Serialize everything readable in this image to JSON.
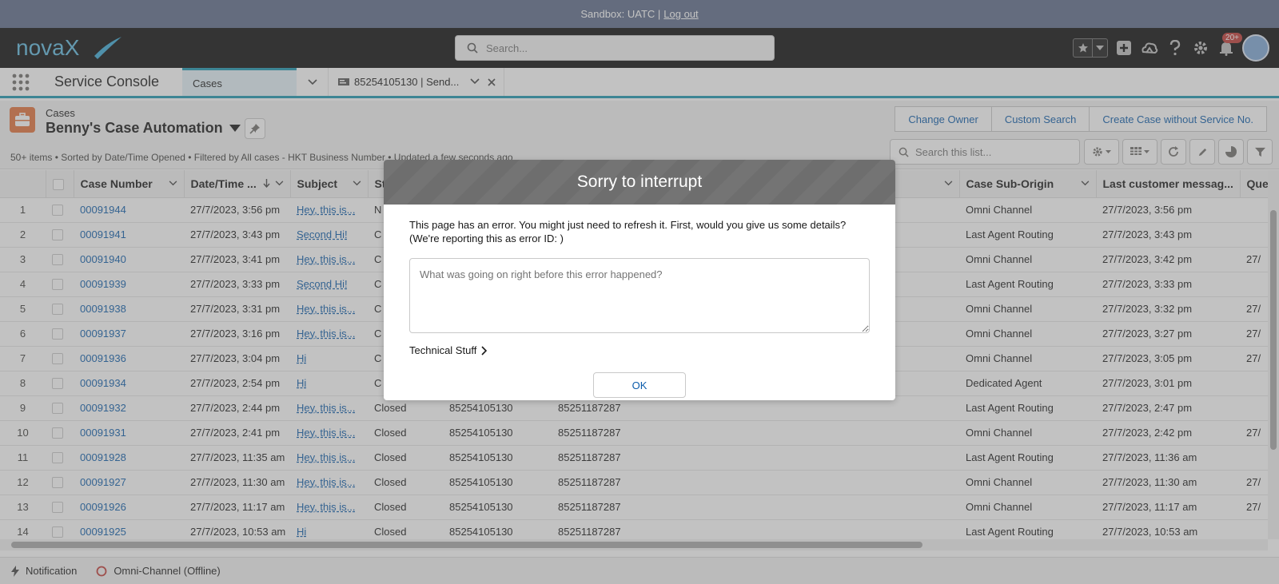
{
  "sandbox": {
    "label": "Sandbox: UATC |",
    "logout": "Log out"
  },
  "header": {
    "logo_text": "novaX",
    "search_placeholder": "Search...",
    "notification_badge": "20+"
  },
  "appnav": {
    "app_name": "Service Console",
    "tabs": [
      {
        "label": "Cases"
      },
      {
        "label": "85254105130 | Send..."
      }
    ]
  },
  "list": {
    "object_label": "Cases",
    "list_name": "Benny's Case Automation",
    "meta": "50+ items • Sorted by Date/Time Opened • Filtered by All cases - HKT Business Number • Updated a few seconds ago",
    "buttons": [
      "Change Owner",
      "Custom Search",
      "Create Case without Service No."
    ],
    "search_placeholder": "Search this list..."
  },
  "table": {
    "columns": [
      "Case Number",
      "Date/Time ...",
      "Subject",
      "St",
      "",
      "",
      "Case Sub-Origin",
      "Last customer messag...",
      "Queue"
    ],
    "rows": [
      {
        "n": "1",
        "case": "00091944",
        "opened": "27/7/2023, 3:56 pm",
        "subject": "Hey, this is...",
        "status": "N",
        "svc": "",
        "contact": "",
        "suborigin": "Omni Channel",
        "last": "27/7/2023, 3:56 pm",
        "queue": ""
      },
      {
        "n": "2",
        "case": "00091941",
        "opened": "27/7/2023, 3:43 pm",
        "subject": "Second Hi!",
        "status": "C",
        "svc": "",
        "contact": "",
        "suborigin": "Last Agent Routing",
        "last": "27/7/2023, 3:43 pm",
        "queue": ""
      },
      {
        "n": "3",
        "case": "00091940",
        "opened": "27/7/2023, 3:41 pm",
        "subject": "Hey, this is...",
        "status": "C",
        "svc": "",
        "contact": "",
        "suborigin": "Omni Channel",
        "last": "27/7/2023, 3:42 pm",
        "queue": "27/"
      },
      {
        "n": "4",
        "case": "00091939",
        "opened": "27/7/2023, 3:33 pm",
        "subject": "Second Hi!",
        "status": "C",
        "svc": "",
        "contact": "",
        "suborigin": "Last Agent Routing",
        "last": "27/7/2023, 3:33 pm",
        "queue": ""
      },
      {
        "n": "5",
        "case": "00091938",
        "opened": "27/7/2023, 3:31 pm",
        "subject": "Hey, this is...",
        "status": "C",
        "svc": "",
        "contact": "",
        "suborigin": "Omni Channel",
        "last": "27/7/2023, 3:32 pm",
        "queue": "27/"
      },
      {
        "n": "6",
        "case": "00091937",
        "opened": "27/7/2023, 3:16 pm",
        "subject": "Hey, this is...",
        "status": "C",
        "svc": "",
        "contact": "",
        "suborigin": "Omni Channel",
        "last": "27/7/2023, 3:27 pm",
        "queue": "27/"
      },
      {
        "n": "7",
        "case": "00091936",
        "opened": "27/7/2023, 3:04 pm",
        "subject": "Hi",
        "status": "C",
        "svc": "",
        "contact": "",
        "suborigin": "Omni Channel",
        "last": "27/7/2023, 3:05 pm",
        "queue": "27/"
      },
      {
        "n": "8",
        "case": "00091934",
        "opened": "27/7/2023, 2:54 pm",
        "subject": "Hi",
        "status": "C",
        "svc": "",
        "contact": "",
        "suborigin": "Dedicated Agent",
        "last": "27/7/2023, 3:01 pm",
        "queue": ""
      },
      {
        "n": "9",
        "case": "00091932",
        "opened": "27/7/2023, 2:44 pm",
        "subject": "Hey, this is...",
        "status": "Closed",
        "svc": "85254105130",
        "contact": "85251187287",
        "suborigin": "Last Agent Routing",
        "last": "27/7/2023, 2:47 pm",
        "queue": ""
      },
      {
        "n": "10",
        "case": "00091931",
        "opened": "27/7/2023, 2:41 pm",
        "subject": "Hey, this is...",
        "status": "Closed",
        "svc": "85254105130",
        "contact": "85251187287",
        "suborigin": "Omni Channel",
        "last": "27/7/2023, 2:42 pm",
        "queue": "27/"
      },
      {
        "n": "11",
        "case": "00091928",
        "opened": "27/7/2023, 11:35 am",
        "subject": "Hey, this is...",
        "status": "Closed",
        "svc": "85254105130",
        "contact": "85251187287",
        "suborigin": "Last Agent Routing",
        "last": "27/7/2023, 11:36 am",
        "queue": ""
      },
      {
        "n": "12",
        "case": "00091927",
        "opened": "27/7/2023, 11:30 am",
        "subject": "Hey, this is...",
        "status": "Closed",
        "svc": "85254105130",
        "contact": "85251187287",
        "suborigin": "Omni Channel",
        "last": "27/7/2023, 11:30 am",
        "queue": "27/"
      },
      {
        "n": "13",
        "case": "00091926",
        "opened": "27/7/2023, 11:17 am",
        "subject": "Hey, this is...",
        "status": "Closed",
        "svc": "85254105130",
        "contact": "85251187287",
        "suborigin": "Omni Channel",
        "last": "27/7/2023, 11:17 am",
        "queue": "27/"
      },
      {
        "n": "14",
        "case": "00091925",
        "opened": "27/7/2023, 10:53 am",
        "subject": "Hi",
        "status": "Closed",
        "svc": "85254105130",
        "contact": "85251187287",
        "suborigin": "Last Agent Routing",
        "last": "27/7/2023, 10:53 am",
        "queue": ""
      }
    ]
  },
  "utility": {
    "notification": "Notification",
    "omni": "Omni-Channel (Offline)"
  },
  "modal": {
    "title": "Sorry to interrupt",
    "message_line1": "This page has an error. You might just need to refresh it. First, would you give us some details?",
    "message_line2": "(We're reporting this as error ID: )",
    "textarea_placeholder": "What was going on right before this error happened?",
    "technical": "Technical Stuff",
    "ok": "OK"
  },
  "colors": {
    "accent": "#1b96b0",
    "link": "#0b5cab",
    "case_icon": "#e3733b",
    "badge": "#c23934"
  },
  "icons": [
    "search-icon",
    "star-icon",
    "plus-icon",
    "help-icon",
    "gear-icon",
    "bell-icon",
    "waffle-icon",
    "briefcase-icon",
    "pin-icon",
    "refresh-icon",
    "pencil-icon",
    "chart-icon",
    "filter-icon",
    "bolt-icon",
    "chevron-right-icon"
  ]
}
